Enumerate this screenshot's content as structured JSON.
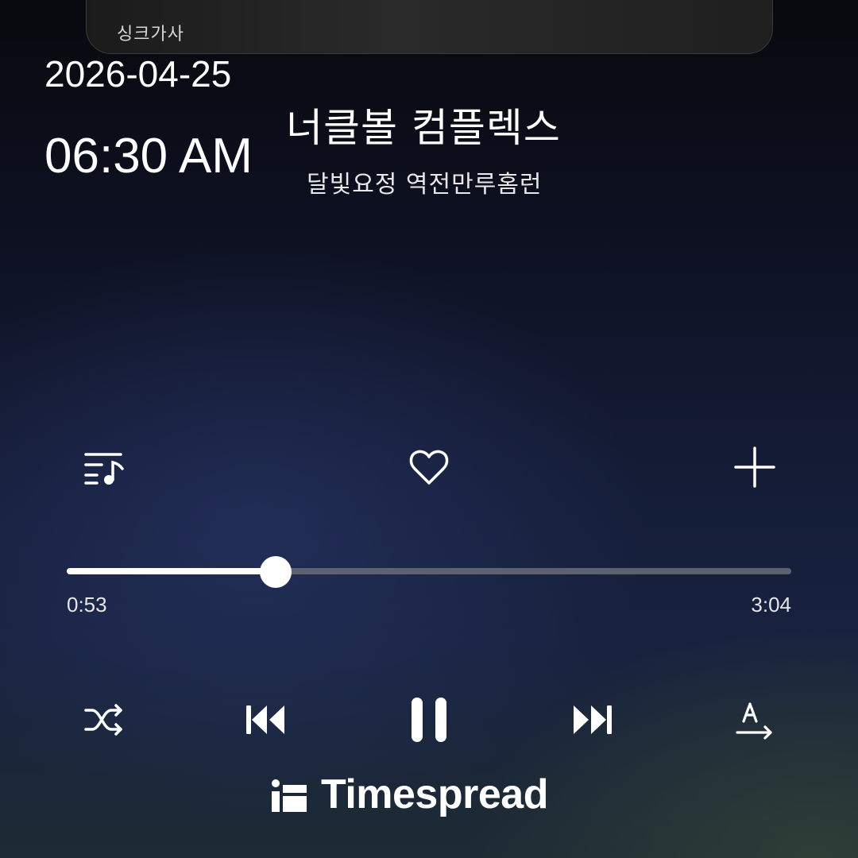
{
  "lyrics_card": {
    "label": "싱크가사"
  },
  "clock": {
    "date": "2026-04-25",
    "time": "06:30 AM"
  },
  "track": {
    "title": "너클볼 컴플렉스",
    "artist": "달빛요정 역전만루홈런"
  },
  "actions": {
    "playlist_icon": "playlist-music-icon",
    "like_icon": "heart-outline-icon",
    "add_icon": "plus-icon"
  },
  "playback": {
    "elapsed": "0:53",
    "total": "3:04",
    "progress_fraction": 0.288,
    "state": "playing"
  },
  "controls": {
    "shuffle_icon": "shuffle-icon",
    "previous_icon": "skip-previous-icon",
    "pause_icon": "pause-icon",
    "next_icon": "skip-next-icon",
    "translate_icon": "lyrics-translate-icon"
  },
  "brand": {
    "name": "Timespread"
  },
  "colors": {
    "progress_played": "#ffffff",
    "progress_track": "#5d6270",
    "text": "#ffffff"
  }
}
